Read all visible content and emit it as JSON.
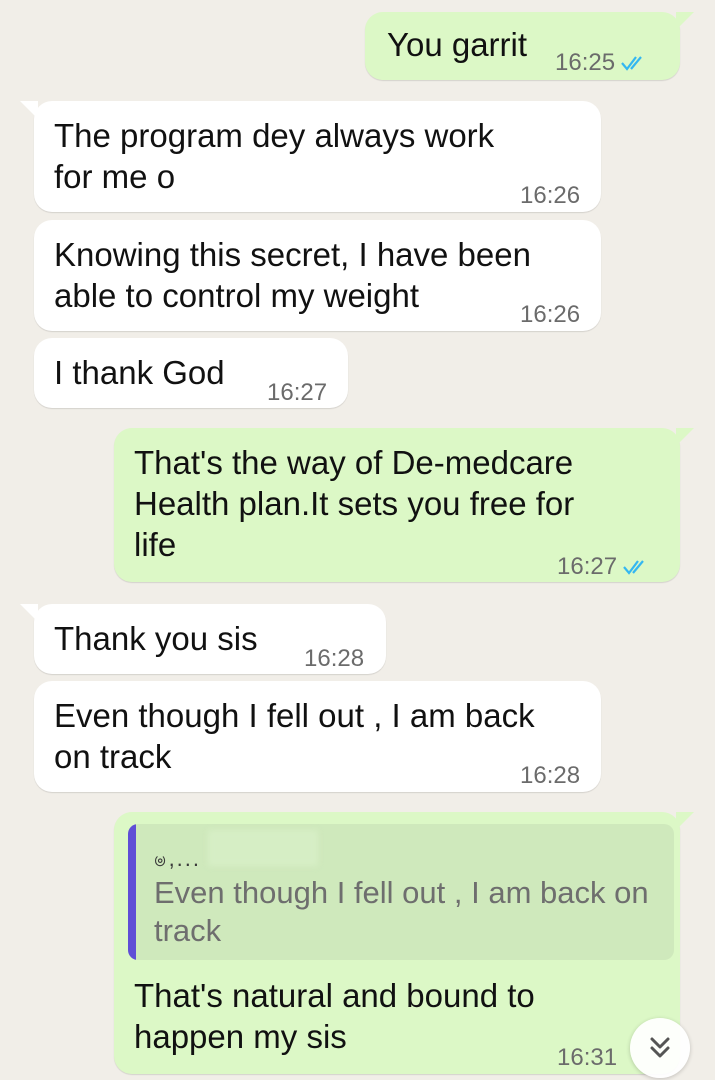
{
  "messages": [
    {
      "direction": "out",
      "text": "You garrit",
      "time": "16:25",
      "status": "read"
    },
    {
      "direction": "in",
      "text": "The program dey always work\nfor me o",
      "time": "16:26"
    },
    {
      "direction": "in",
      "text": "Knowing this secret, I have been\nable to control my weight",
      "time": "16:26"
    },
    {
      "direction": "in",
      "text": "I thank God",
      "time": "16:27"
    },
    {
      "direction": "out",
      "text": "That's the way of De-medcare\nHealth plan.It sets you free for\nlife",
      "time": "16:27",
      "status": "read"
    },
    {
      "direction": "in",
      "text": "Thank you sis",
      "time": "16:28"
    },
    {
      "direction": "in",
      "text": "Even though I fell out , I am back\non track",
      "time": "16:28"
    },
    {
      "direction": "out",
      "quoted": {
        "author": "ၑ​,...",
        "text": "Even though I fell out , I am back on\ntrack"
      },
      "text": "That's natural and bound to\nhappen my sis",
      "time": "16:31"
    }
  ],
  "colors": {
    "background": "#f1eee8",
    "incoming_bubble": "#ffffff",
    "outgoing_bubble": "#dcf8c6",
    "read_ticks": "#34b7f1",
    "quote_bar": "#5f4ed6"
  },
  "icons": {
    "read_receipt": "double-check-icon",
    "scroll_down": "double-chevron-down-icon"
  }
}
